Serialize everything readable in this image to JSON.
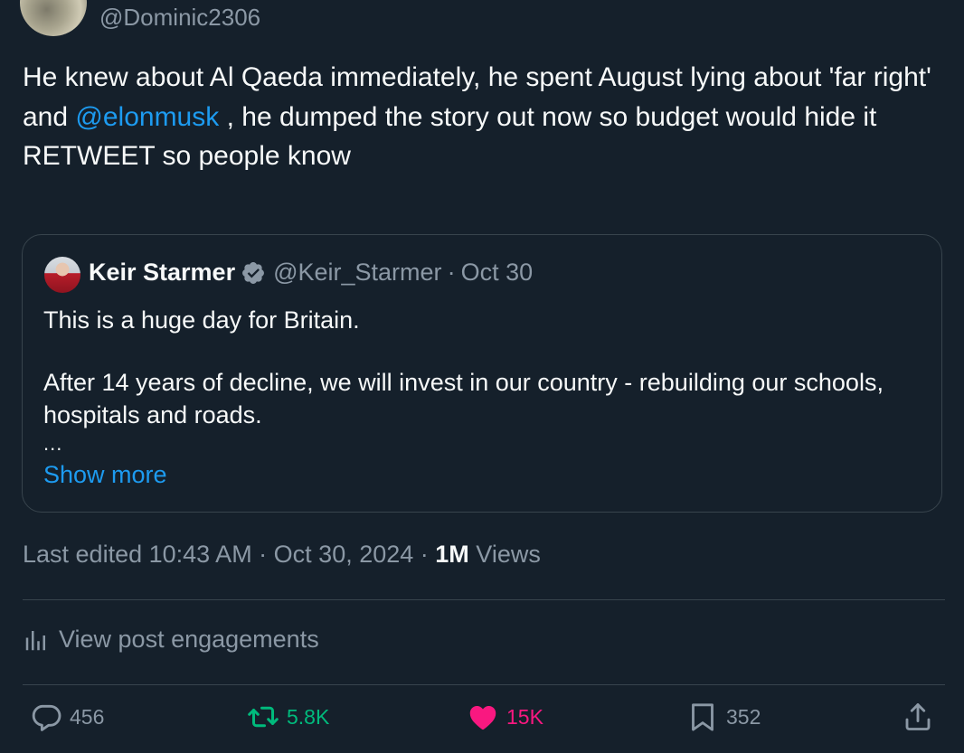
{
  "author": {
    "handle": "@Dominic2306"
  },
  "post": {
    "line1": "He knew about Al Qaeda immediately, he spent August lying about 'far right' and ",
    "mention": "@elonmusk",
    "line1b": " , he dumped the story out now so budget would hide it",
    "line2": "RETWEET so people know"
  },
  "quote": {
    "name": "Keir Starmer",
    "handle": "@Keir_Starmer",
    "separator": "·",
    "date": "Oct 30",
    "para1": "This is a huge day for Britain.",
    "para2": "After 14 years of decline, we will invest in our country - rebuilding our schools, hospitals and roads.",
    "ellipsis": "...",
    "show_more": "Show more"
  },
  "meta": {
    "edited": "Last edited 10:43 AM · Oct 30, 2024 · ",
    "views_count": "1M",
    "views_label": " Views"
  },
  "engagements": {
    "label": "View post engagements"
  },
  "actions": {
    "replies": "456",
    "reposts": "5.8K",
    "likes": "15K",
    "bookmarks": "352"
  },
  "colors": {
    "background": "#15202b",
    "link": "#1d9bf0",
    "muted": "#8b98a5",
    "repost": "#00ba7c",
    "like": "#f91880",
    "border": "#38444d"
  },
  "icons": [
    "reply-icon",
    "repost-icon",
    "heart-icon",
    "bookmark-icon",
    "share-icon",
    "analytics-icon",
    "verified-icon"
  ]
}
